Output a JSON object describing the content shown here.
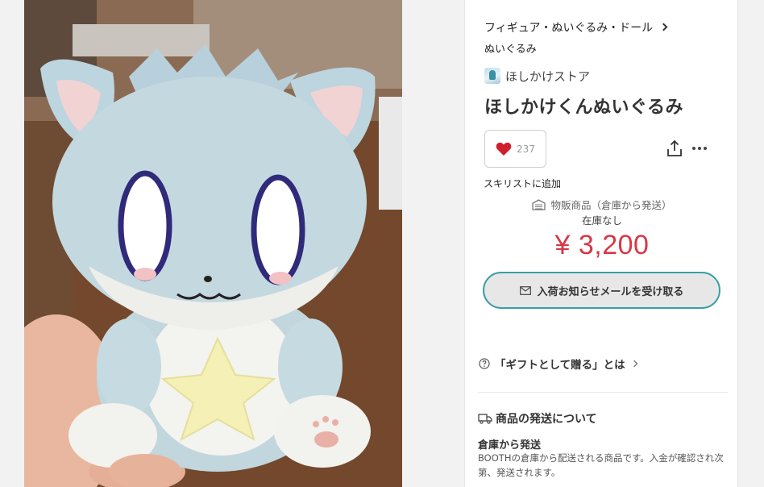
{
  "photo": {
    "alt": ""
  },
  "breadcrumb": {
    "category": "フィギュア・ぬいぐるみ・ドール",
    "subcategory": "ぬいぐるみ"
  },
  "shop": {
    "name": "ほしかけストア",
    "avatar_icon": "shop-avatar-icon"
  },
  "product": {
    "title": "ほしかけくんぬいぐるみ",
    "like_count": "237",
    "wishlist_label": "スキリストに追加",
    "shipping_type": "物販商品（倉庫から発送）",
    "stock_status": "在庫なし",
    "price": "¥ 3,200"
  },
  "actions": {
    "notify_label": "入荷お知らせメールを受け取る",
    "gift_label": "「ギフトとして贈る」とは"
  },
  "shipping_info": {
    "heading": "商品の発送について",
    "method": "倉庫から発送",
    "description": "BOOTHの倉庫から配送される商品です。入金が確認され次第、発送されます。"
  },
  "colors": {
    "price": "#d93745",
    "heart": "#d0202e",
    "notify_border": "#3a9ea5",
    "notify_bg": "#e7e7e7"
  },
  "icons": {
    "like": "heart-icon",
    "share": "share-icon",
    "more": "more-icon",
    "warehouse": "warehouse-icon",
    "mail": "mail-icon",
    "help": "help-icon",
    "truck": "truck-icon",
    "breadcrumb_next": "chevron-right-icon"
  }
}
